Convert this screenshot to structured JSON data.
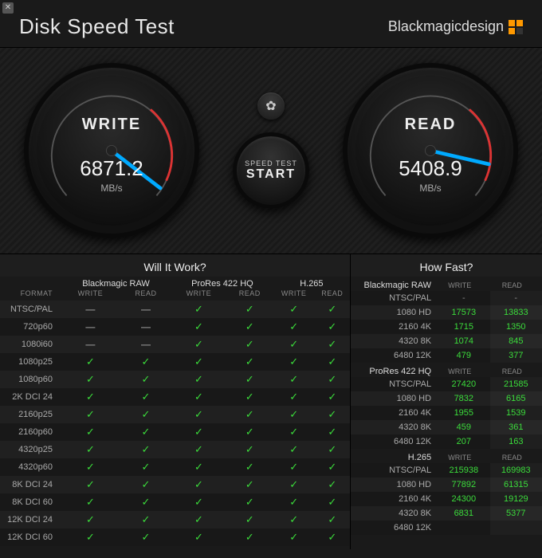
{
  "app": {
    "title": "Disk Speed Test",
    "brand": "Blackmagicdesign"
  },
  "gauges": {
    "write": {
      "label": "WRITE",
      "value": "6871.2",
      "unit": "MB/s",
      "angle": 130
    },
    "read": {
      "label": "READ",
      "value": "5408.9",
      "unit": "MB/s",
      "angle": 165
    }
  },
  "center": {
    "start_small": "SPEED TEST",
    "start_big": "START"
  },
  "left": {
    "title": "Will It Work?",
    "format_header": "FORMAT",
    "codecs": [
      "Blackmagic RAW",
      "ProRes 422 HQ",
      "H.265"
    ],
    "sub": [
      "WRITE",
      "READ"
    ],
    "rows": [
      {
        "name": "NTSC/PAL",
        "cells": [
          "-",
          "-",
          "y",
          "y",
          "y",
          "y"
        ]
      },
      {
        "name": "720p60",
        "cells": [
          "-",
          "-",
          "y",
          "y",
          "y",
          "y"
        ]
      },
      {
        "name": "1080i60",
        "cells": [
          "-",
          "-",
          "y",
          "y",
          "y",
          "y"
        ]
      },
      {
        "name": "1080p25",
        "cells": [
          "y",
          "y",
          "y",
          "y",
          "y",
          "y"
        ]
      },
      {
        "name": "1080p60",
        "cells": [
          "y",
          "y",
          "y",
          "y",
          "y",
          "y"
        ]
      },
      {
        "name": "2K DCI 24",
        "cells": [
          "y",
          "y",
          "y",
          "y",
          "y",
          "y"
        ]
      },
      {
        "name": "2160p25",
        "cells": [
          "y",
          "y",
          "y",
          "y",
          "y",
          "y"
        ]
      },
      {
        "name": "2160p60",
        "cells": [
          "y",
          "y",
          "y",
          "y",
          "y",
          "y"
        ]
      },
      {
        "name": "4320p25",
        "cells": [
          "y",
          "y",
          "y",
          "y",
          "y",
          "y"
        ]
      },
      {
        "name": "4320p60",
        "cells": [
          "y",
          "y",
          "y",
          "y",
          "y",
          "y"
        ]
      },
      {
        "name": "8K DCI 24",
        "cells": [
          "y",
          "y",
          "y",
          "y",
          "y",
          "y"
        ]
      },
      {
        "name": "8K DCI 60",
        "cells": [
          "y",
          "y",
          "y",
          "y",
          "y",
          "y"
        ]
      },
      {
        "name": "12K DCI 24",
        "cells": [
          "y",
          "y",
          "y",
          "y",
          "y",
          "y"
        ]
      },
      {
        "name": "12K DCI 60",
        "cells": [
          "y",
          "y",
          "y",
          "y",
          "y",
          "y"
        ]
      }
    ]
  },
  "right": {
    "title": "How Fast?",
    "sub": [
      "WRITE",
      "READ"
    ],
    "groups": [
      {
        "codec": "Blackmagic RAW",
        "rows": [
          {
            "name": "NTSC/PAL",
            "write": "-",
            "read": "-"
          },
          {
            "name": "1080 HD",
            "write": "17573",
            "read": "13833"
          },
          {
            "name": "2160 4K",
            "write": "1715",
            "read": "1350"
          },
          {
            "name": "4320 8K",
            "write": "1074",
            "read": "845"
          },
          {
            "name": "6480 12K",
            "write": "479",
            "read": "377"
          }
        ]
      },
      {
        "codec": "ProRes 422 HQ",
        "rows": [
          {
            "name": "NTSC/PAL",
            "write": "27420",
            "read": "21585"
          },
          {
            "name": "1080 HD",
            "write": "7832",
            "read": "6165"
          },
          {
            "name": "2160 4K",
            "write": "1955",
            "read": "1539"
          },
          {
            "name": "4320 8K",
            "write": "459",
            "read": "361"
          },
          {
            "name": "6480 12K",
            "write": "207",
            "read": "163"
          }
        ]
      },
      {
        "codec": "H.265",
        "rows": [
          {
            "name": "NTSC/PAL",
            "write": "215938",
            "read": "169983"
          },
          {
            "name": "1080 HD",
            "write": "77892",
            "read": "61315"
          },
          {
            "name": "2160 4K",
            "write": "24300",
            "read": "19129"
          },
          {
            "name": "4320 8K",
            "write": "6831",
            "read": "5377"
          },
          {
            "name": "6480 12K",
            "write": "",
            "read": ""
          }
        ]
      }
    ]
  }
}
